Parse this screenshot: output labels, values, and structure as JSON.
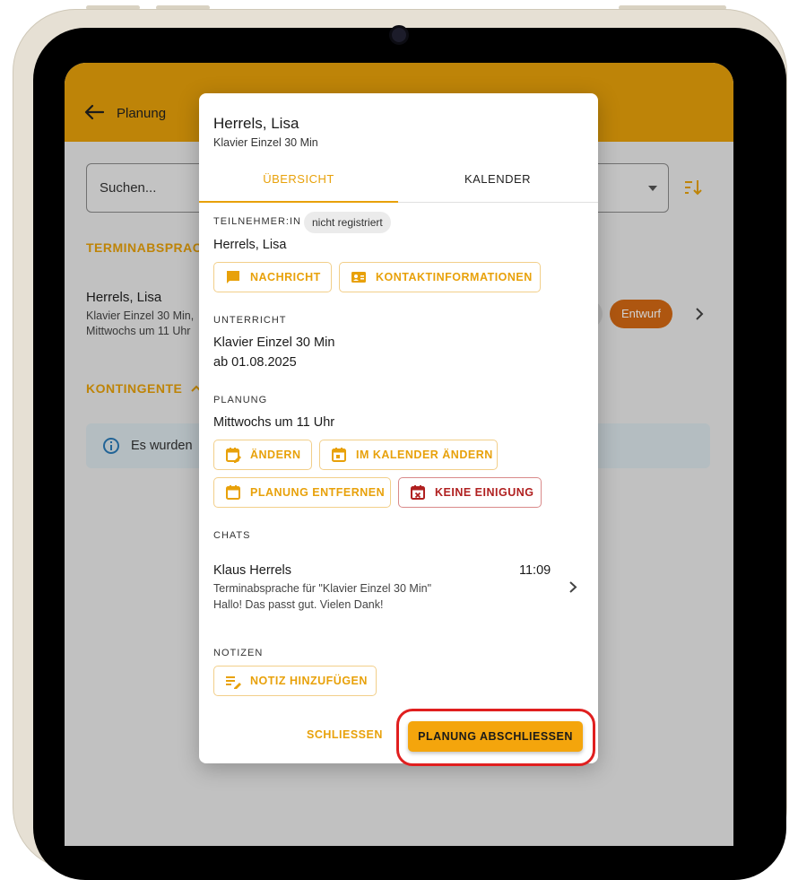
{
  "appbar": {
    "title": "Planung"
  },
  "search": {
    "placeholder": "Suchen..."
  },
  "background": {
    "section_title": "TERMINABSPRACH",
    "item_name": "Herrels, Lisa",
    "item_sub1": "Klavier Einzel 30 Min,",
    "item_sub2": "Mittwochs um 11 Uhr",
    "badge": "Entwurf",
    "kontingente": "KONTINGENTE",
    "info_text": "Es wurden"
  },
  "dialog": {
    "title": "Herrels, Lisa",
    "subtitle": "Klavier Einzel 30 Min",
    "tabs": [
      "ÜBERSICHT",
      "KALENDER"
    ],
    "participant": {
      "label": "TEILNEHMER:IN",
      "chip": "nicht registriert",
      "name": "Herrels, Lisa",
      "btn_message": "NACHRICHT",
      "btn_contact": "KONTAKTINFORMATIONEN"
    },
    "lesson": {
      "label": "UNTERRICHT",
      "line1": "Klavier Einzel 30 Min",
      "line2": "ab 01.08.2025"
    },
    "planning": {
      "label": "PLANUNG",
      "text": "Mittwochs um 11 Uhr",
      "btn_change": "ÄNDERN",
      "btn_calendar_change": "IM KALENDER ÄNDERN",
      "btn_remove": "PLANUNG ENTFERNEN",
      "btn_no_agreement": "KEINE EINIGUNG"
    },
    "chats": {
      "label": "CHATS",
      "name": "Klaus Herrels",
      "time": "11:09",
      "line1": "Terminabsprache für \"Klavier Einzel 30 Min\"",
      "line2": "Hallo! Das passt gut. Vielen Dank!"
    },
    "notes": {
      "label": "NOTIZEN",
      "btn_add": "NOTIZ HINZUFÜGEN"
    },
    "actions": {
      "close": "SCHLIESSEN",
      "finish": "PLANUNG ABSCHLIESSEN"
    }
  },
  "colors": {
    "accent": "#e8a10a",
    "primary_button": "#f4a50c",
    "danger": "#b02020",
    "highlight": "#e01f1f",
    "badge": "#d56a14"
  }
}
